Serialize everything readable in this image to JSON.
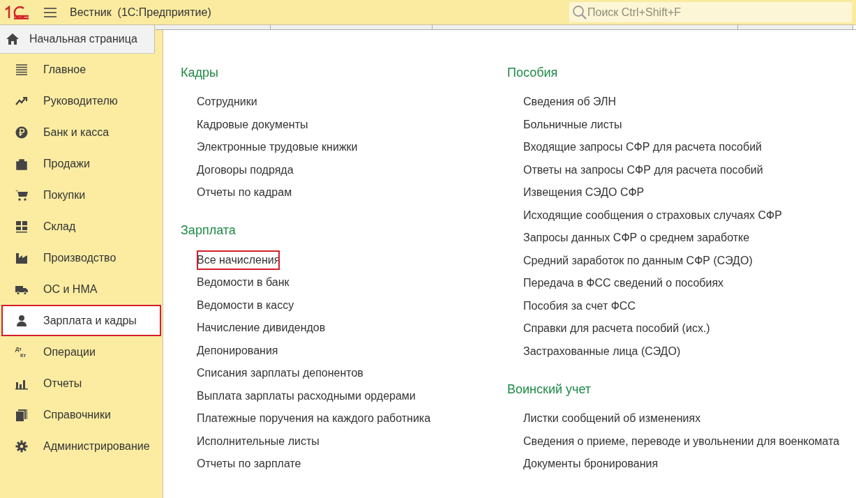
{
  "header": {
    "title": "Вестник",
    "subtitle": "(1С:Предприятие)",
    "search": {
      "placeholder": "Поиск Ctrl+Shift+F"
    }
  },
  "home_tab": {
    "label": "Начальная страница"
  },
  "sidebar": {
    "items": [
      {
        "label": "Главное",
        "selected": false
      },
      {
        "label": "Руководителю",
        "selected": false
      },
      {
        "label": "Банк и касса",
        "selected": false
      },
      {
        "label": "Продажи",
        "selected": false
      },
      {
        "label": "Покупки",
        "selected": false
      },
      {
        "label": "Склад",
        "selected": false
      },
      {
        "label": "Производство",
        "selected": false
      },
      {
        "label": "ОС и НМА",
        "selected": false
      },
      {
        "label": "Зарплата и кадры",
        "selected": true
      },
      {
        "label": "Операции",
        "icon_labels": [
          "Дт",
          "Кт"
        ],
        "selected": false
      },
      {
        "label": "Отчеты",
        "selected": false
      },
      {
        "label": "Справочники",
        "selected": false
      },
      {
        "label": "Администрирование",
        "selected": false
      }
    ]
  },
  "columns": [
    {
      "sections": [
        {
          "title": "Кадры",
          "links": [
            {
              "label": "Сотрудники",
              "highlighted": false
            },
            {
              "label": "Кадровые документы",
              "highlighted": false
            },
            {
              "label": "Электронные трудовые книжки",
              "highlighted": false
            },
            {
              "label": "Договоры подряда",
              "highlighted": false
            },
            {
              "label": "Отчеты по кадрам",
              "highlighted": false
            }
          ]
        },
        {
          "title": "Зарплата",
          "links": [
            {
              "label": "Все начисления",
              "highlighted": true
            },
            {
              "label": "Ведомости в банк",
              "highlighted": false
            },
            {
              "label": "Ведомости в кассу",
              "highlighted": false
            },
            {
              "label": "Начисление дивидендов",
              "highlighted": false
            },
            {
              "label": "Депонирования",
              "highlighted": false
            },
            {
              "label": "Списания зарплаты депонентов",
              "highlighted": false
            },
            {
              "label": "Выплата зарплаты расходными ордерами",
              "highlighted": false
            },
            {
              "label": "Платежные поручения на каждого работника",
              "highlighted": false
            },
            {
              "label": "Исполнительные листы",
              "highlighted": false
            },
            {
              "label": "Отчеты по зарплате",
              "highlighted": false
            }
          ]
        }
      ]
    },
    {
      "sections": [
        {
          "title": "Пособия",
          "links": [
            {
              "label": "Сведения об ЭЛН",
              "highlighted": false
            },
            {
              "label": "Больничные листы",
              "highlighted": false
            },
            {
              "label": "Входящие запросы СФР для расчета пособий",
              "highlighted": false
            },
            {
              "label": "Ответы на запросы СФР для расчета пособий",
              "highlighted": false
            },
            {
              "label": "Извещения СЭДО СФР",
              "highlighted": false
            },
            {
              "label": "Исходящие сообщения о страховых случаях СФР",
              "highlighted": false
            },
            {
              "label": "Запросы данных СФР о среднем заработке",
              "highlighted": false
            },
            {
              "label": "Средний заработок по данным СФР (СЭДО)",
              "highlighted": false
            },
            {
              "label": "Передача в ФСС сведений о пособиях",
              "highlighted": false
            },
            {
              "label": "Пособия за счет ФСС",
              "highlighted": false
            },
            {
              "label": "Справки для расчета пособий (исх.)",
              "highlighted": false
            },
            {
              "label": "Застрахованные лица (СЭДО)",
              "highlighted": false
            }
          ]
        },
        {
          "title": "Воинский учет",
          "links": [
            {
              "label": "Листки сообщений об изменениях",
              "highlighted": false
            },
            {
              "label": "Сведения о приеме, переводе и увольнении для военкомата",
              "highlighted": false
            },
            {
              "label": "Документы бронирования",
              "highlighted": false
            }
          ]
        }
      ]
    }
  ]
}
